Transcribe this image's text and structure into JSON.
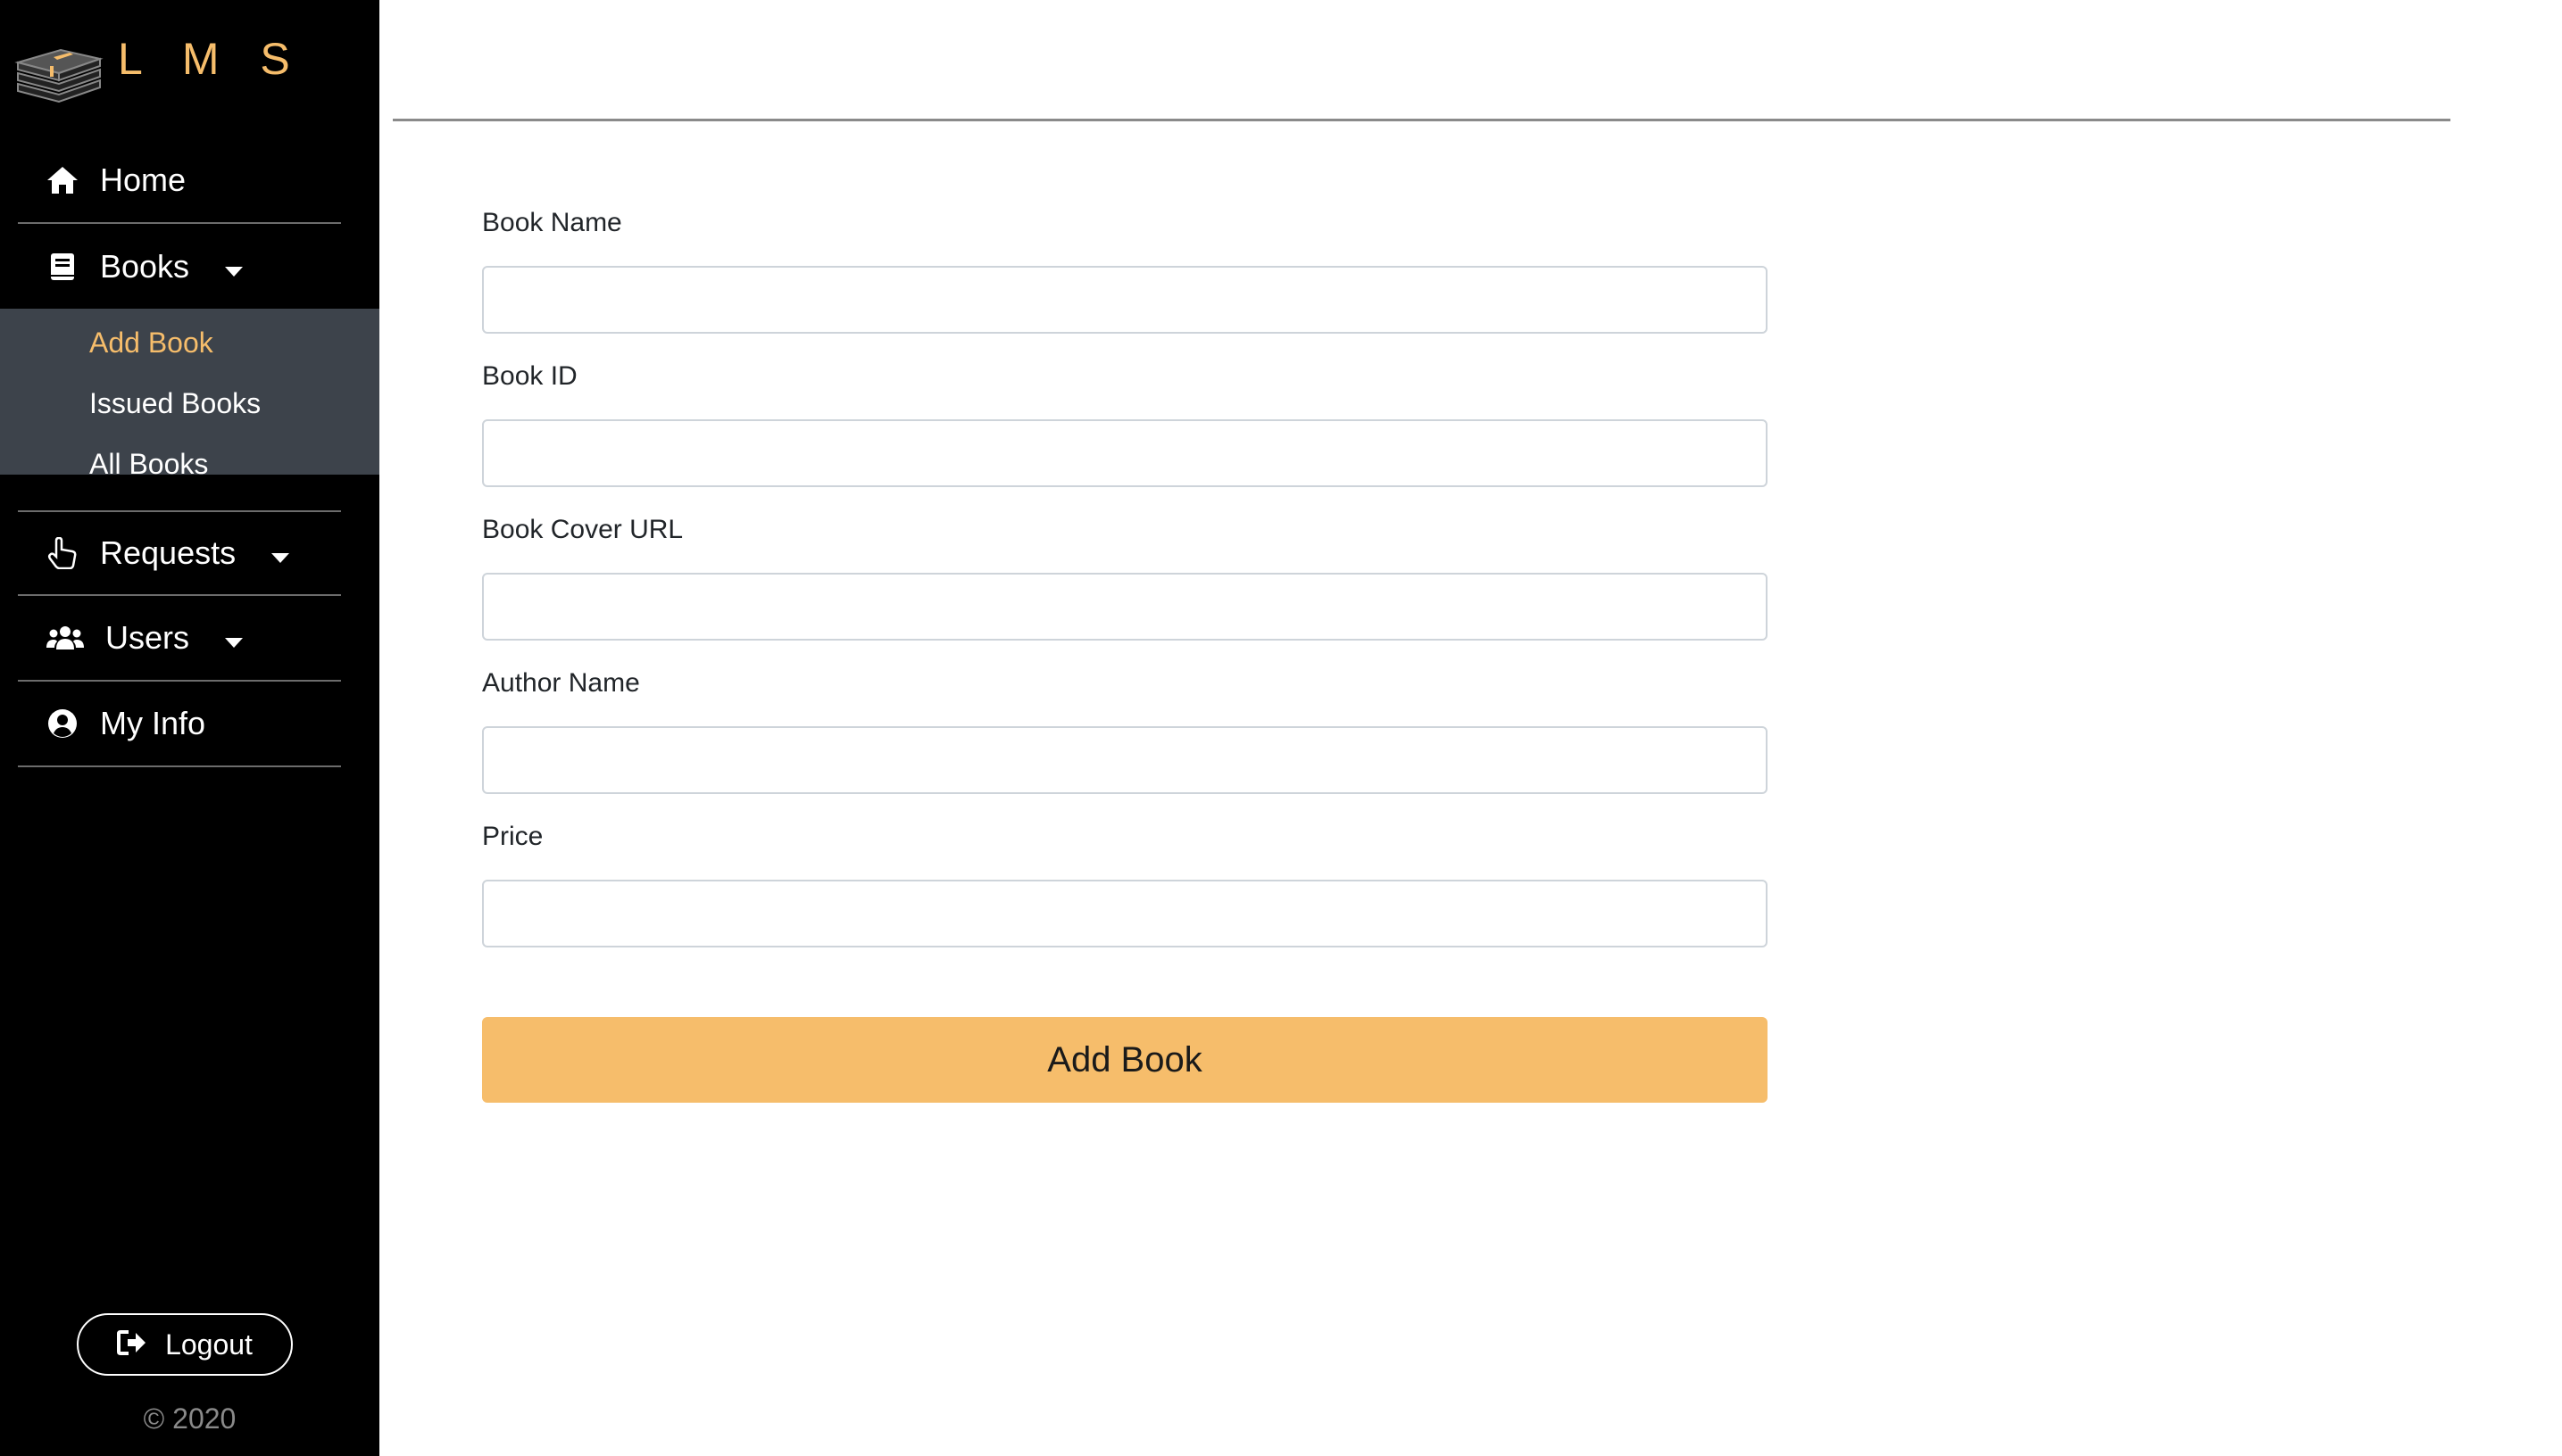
{
  "brand": {
    "title": "L M S",
    "accent_color": "#f6bd6b",
    "logo_icon": "stacked-books-icon"
  },
  "sidebar": {
    "items": [
      {
        "label": "Home",
        "icon": "home-icon"
      },
      {
        "label": "Books",
        "icon": "book-icon",
        "expanded": true
      },
      {
        "label": "Requests",
        "icon": "hand-pointer-icon"
      },
      {
        "label": "Users",
        "icon": "users-icon"
      },
      {
        "label": "My Info",
        "icon": "user-circle-icon"
      }
    ],
    "books_submenu": [
      {
        "label": "Add Book",
        "active": true
      },
      {
        "label": "Issued Books"
      },
      {
        "label": "All Books"
      }
    ],
    "logout_label": "Logout",
    "copyright": "© 2020"
  },
  "form": {
    "fields": [
      {
        "label": "Book Name",
        "value": ""
      },
      {
        "label": "Book ID",
        "value": ""
      },
      {
        "label": "Book Cover URL",
        "value": ""
      },
      {
        "label": "Author Name",
        "value": ""
      },
      {
        "label": "Price",
        "value": ""
      }
    ],
    "submit_label": "Add Book"
  },
  "colors": {
    "sidebar_bg": "#000000",
    "submenu_bg": "#3d434b",
    "button_bg": "#f6bd6b"
  }
}
